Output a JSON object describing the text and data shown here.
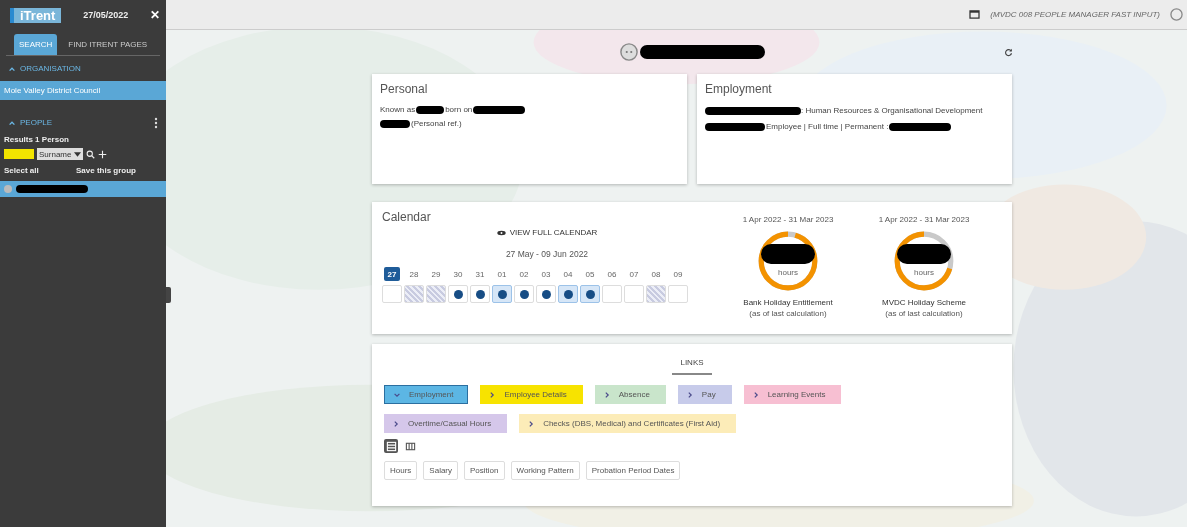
{
  "sidebar": {
    "logo": "iTrent",
    "date": "27/05/2022",
    "close": "✕",
    "tabs": [
      {
        "label": "SEARCH",
        "selected": true
      },
      {
        "label": "FIND ITRENT PAGES",
        "selected": false
      }
    ],
    "organisation": {
      "heading": "ORGANISATION",
      "expanded": true,
      "items": [
        {
          "label": "Mole Valley District Council",
          "selected": true
        }
      ]
    },
    "people": {
      "heading": "PEOPLE",
      "expanded": true,
      "results": "Results 1 Person",
      "search_by": "Surname",
      "select_all": "Select all",
      "save_group": "Save this group",
      "items": [
        {
          "selected": true
        }
      ]
    }
  },
  "top_bar": {
    "role": "(MVDC 008 PEOPLE MANAGER FAST INPUT)"
  },
  "personal": {
    "title": "Personal",
    "known_as": "Known as",
    "born_on": "born on",
    "ref": "(Personal ref.)"
  },
  "employment": {
    "title": "Employment",
    "department": ": Human Resources & Organisational Development",
    "contract": "Employee | Full time | Permanent :"
  },
  "calendar": {
    "title": "Calendar",
    "view_full": "VIEW FULL CALENDAR",
    "range": "27 May - 09 Jun 2022",
    "days": [
      {
        "label": "27",
        "selected": true,
        "kind": "empty"
      },
      {
        "label": "28",
        "selected": false,
        "kind": "hatched"
      },
      {
        "label": "29",
        "selected": false,
        "kind": "hatched"
      },
      {
        "label": "30",
        "selected": false,
        "kind": "dot"
      },
      {
        "label": "31",
        "selected": false,
        "kind": "dot"
      },
      {
        "label": "01",
        "selected": false,
        "kind": "dot-marked"
      },
      {
        "label": "02",
        "selected": false,
        "kind": "dot"
      },
      {
        "label": "03",
        "selected": false,
        "kind": "dot"
      },
      {
        "label": "04",
        "selected": false,
        "kind": "dot-marked"
      },
      {
        "label": "05",
        "selected": false,
        "kind": "dot-marked"
      },
      {
        "label": "06",
        "selected": false,
        "kind": "empty"
      },
      {
        "label": "07",
        "selected": false,
        "kind": "empty"
      },
      {
        "label": "08",
        "selected": false,
        "kind": "hatched"
      },
      {
        "label": "09",
        "selected": false,
        "kind": "empty"
      }
    ],
    "balances": [
      {
        "period": "1 Apr 2022 - 31 Mar 2023",
        "level": 0.95,
        "unit": "hours",
        "name": "Bank Holiday Entitlement",
        "note": "(as of last calculation)"
      },
      {
        "period": "1 Apr 2022 - 31 Mar 2023",
        "level": 0.7,
        "unit": "hours",
        "name": "MVDC Holiday Scheme",
        "note": "(as of last calculation)"
      }
    ]
  },
  "links": {
    "tab": "LINKS",
    "items": [
      {
        "label": "Employment",
        "color": "#5cb6e4",
        "expanded": true
      },
      {
        "label": "Employee Details",
        "color": "#f7e300",
        "expanded": false
      },
      {
        "label": "Absence",
        "color": "#c9e5cb",
        "expanded": false
      },
      {
        "label": "Pay",
        "color": "#c7cbea",
        "expanded": false
      },
      {
        "label": "Learning Events",
        "color": "#f7bfd2",
        "expanded": false
      },
      {
        "label": "Overtime/Casual Hours",
        "color": "#d5c7ea",
        "expanded": false
      },
      {
        "label": "Checks (DBS, Medical) and Certificates (First Aid)",
        "color": "#fcecb8",
        "expanded": false
      }
    ],
    "views": [
      {
        "kind": "list",
        "selected": true
      },
      {
        "kind": "columns",
        "selected": false
      }
    ],
    "sub_items": [
      "Hours",
      "Salary",
      "Position",
      "Working Pattern",
      "Probation Period Dates"
    ]
  }
}
